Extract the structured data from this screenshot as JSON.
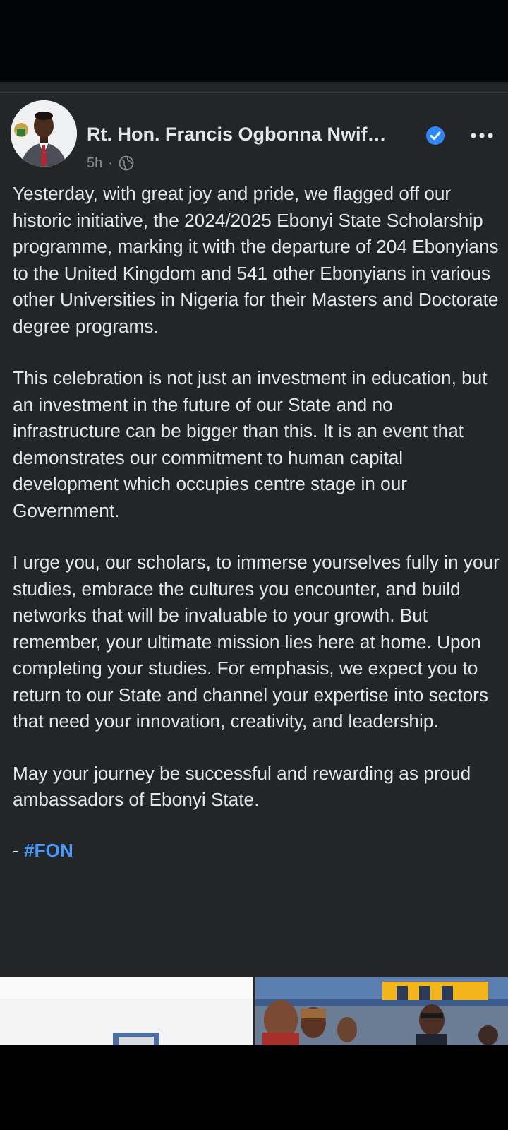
{
  "post": {
    "author": "Rt. Hon. Francis Ogbonna Nwif…",
    "timestamp": "5h",
    "separator": "·",
    "audience_icon": "globe-icon",
    "verified_icon": "verified-badge-icon",
    "more_icon": "more-options-icon",
    "paragraphs": [
      "Yesterday, with great joy and pride, we flagged off our historic initiative, the 2024/2025 Ebonyi State Scholarship programme, marking it with the departure of 204 Ebonyians to the United Kingdom and 541 other Ebonyians in various other Universities in Nigeria for their Masters and Doctorate degree programs.",
      "This celebration is not just an investment in education, but an investment in the future of our State and no infrastructure can be bigger than this. It is an event that demonstrates our commitment to human capital development which occupies centre stage in our Government.",
      "I urge you, our scholars, to immerse yourselves fully in your studies, embrace the cultures you encounter, and build networks that will be invaluable to your growth. But remember, your ultimate mission lies here at home. Upon completing your studies. For emphasis, we expect you to return to our State and channel your expertise into sectors that need your innovation, creativity, and leadership.",
      "May your journey be successful and rewarding as proud ambassadors of Ebonyi State."
    ],
    "signoff_prefix": "- ",
    "hashtag": "#FON"
  },
  "colors": {
    "background": "#242526",
    "text": "#e4e6eb",
    "secondary_text": "#8a8d91",
    "hashtag": "#4599ff",
    "verified": "#2d88ff"
  }
}
